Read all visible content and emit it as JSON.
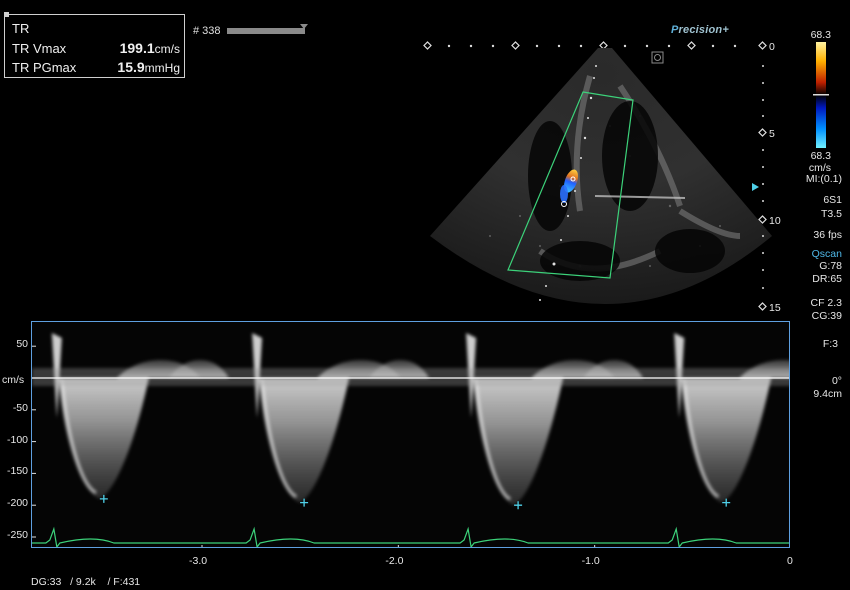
{
  "measurement": {
    "title": "TR",
    "rows": [
      {
        "label": "TR Vmax",
        "value": "199.1",
        "unit": "cm/s"
      },
      {
        "label": "TR PGmax",
        "value": "15.9",
        "unit": "mmHg"
      }
    ]
  },
  "frame": {
    "label": "# 338"
  },
  "brand": {
    "prefix": "P",
    "rest": "recision+"
  },
  "colorscale": {
    "top": "68.3",
    "bottom": "68.3",
    "unit": "cm/s",
    "mi": "MI:(0.1)"
  },
  "settings": {
    "probe": "6S1",
    "t": "T3.5",
    "fps": "36 fps",
    "qscan": "Qscan",
    "gain": "G:78",
    "dr": "DR:65",
    "cf": "CF 2.3",
    "cg": "CG:39",
    "f": "F:3",
    "angle": "0°",
    "depth": "9.4cm"
  },
  "depth_scale": [
    "0",
    "5",
    "10",
    "15"
  ],
  "velocity_axis": {
    "unit": "cm/s",
    "ticks": [
      "50",
      "",
      "-50",
      "-100",
      "-150",
      "-200",
      "-250"
    ],
    "values": [
      50,
      0,
      -50,
      -100,
      -150,
      -200,
      -250
    ]
  },
  "time_axis": {
    "ticks": [
      "-3.0",
      "-2.0",
      "-1.0",
      "0"
    ],
    "values": [
      -3.0,
      -2.0,
      -1.0,
      0
    ]
  },
  "bottom_info": "DG:33   / 9.2k    / F:431",
  "markers": [
    {
      "time": -3.5,
      "velocity": -190
    },
    {
      "time": -2.48,
      "velocity": -196
    },
    {
      "time": -1.39,
      "velocity": -200
    },
    {
      "time": -0.33,
      "velocity": -196
    }
  ],
  "colors": {
    "border": "#5fa0e0",
    "ecg": "#3cd27a",
    "marker": "#4fd0e8",
    "baseline": "#ffffff"
  }
}
